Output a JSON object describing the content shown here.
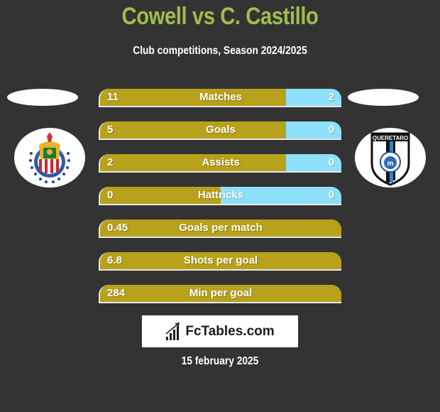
{
  "header": {
    "title": "Cowell vs C. Castillo",
    "subtitle": "Club competitions, Season 2024/2025"
  },
  "teams": {
    "left": {
      "logo": "chivas-guadalajara-crest-icon"
    },
    "right": {
      "logo": "queretaro-crest-icon"
    }
  },
  "colors": {
    "background": "#333333",
    "title": "#a0bd4a",
    "left_bar": "#b8a11b",
    "right_bar": "#8ee0fb"
  },
  "stats": [
    {
      "label": "Matches",
      "left": "11",
      "right": "2",
      "left_share": 0.77
    },
    {
      "label": "Goals",
      "left": "5",
      "right": "0",
      "left_share": 0.77
    },
    {
      "label": "Assists",
      "left": "2",
      "right": "0",
      "left_share": 0.77
    },
    {
      "label": "Hattricks",
      "left": "0",
      "right": "0",
      "left_share": 0.5
    },
    {
      "label": "Goals per match",
      "left": "0.45",
      "right": "",
      "left_share": 1.0
    },
    {
      "label": "Shots per goal",
      "left": "6.8",
      "right": "",
      "left_share": 1.0
    },
    {
      "label": "Min per goal",
      "left": "284",
      "right": "",
      "left_share": 1.0
    }
  ],
  "footer": {
    "brand": "FcTables.com",
    "brand_icon": "bar-chart-icon",
    "date": "15 february 2025"
  }
}
